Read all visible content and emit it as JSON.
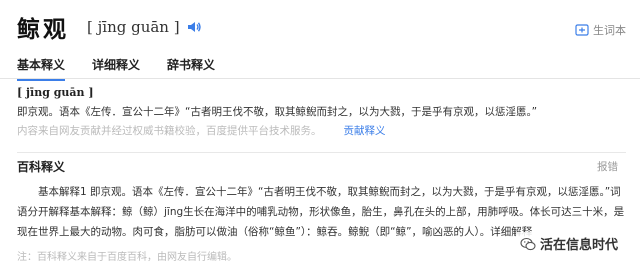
{
  "header": {
    "word": "鲸观",
    "pinyin": "[ jīng guān ]",
    "vocab_label": "生词本"
  },
  "tabs": [
    {
      "label": "基本释义",
      "active": true
    },
    {
      "label": "详细释义",
      "active": false
    },
    {
      "label": "辞书释义",
      "active": false
    }
  ],
  "basic": {
    "pinyin": "[ jīng guān ]",
    "definition": "即京观。语本《左传．宣公十二年》“古者明王伐不敬，取其鲸鲵而封之，以为大戮，于是乎有京观，以惩淫慝。”",
    "note": "内容来自网友贡献并经过权威书籍校验，百度提供平台技术服务。",
    "contribute_label": "贡献释义"
  },
  "baike": {
    "title": "百科释义",
    "report_label": "报错",
    "body": "基本解释1 即京观。语本《左传．宣公十二年》“古者明王伐不敬，取其鲸鲵而封之，以为大戮，于是乎有京观，以惩淫慝。”词语分开解释基本解释：鲸（鲸）jīng生长在海洋中的哺乳动物，形状像鱼，胎生，鼻孔在头的上部，用肺呼吸。体长可达三十米，是现在世界上最大的动物。肉可食，脂肪可以做油（俗称“鲸鱼”）：鲸吞。鲸鲵（即“鲸”，喻凶恶的人）。详细解释",
    "note": "注：百科释义来自于百度百科，由网友自行编辑。"
  },
  "watermark": {
    "text": "活在信息时代"
  },
  "colors": {
    "accent": "#3b7ee8",
    "muted": "#bbbbbb"
  }
}
